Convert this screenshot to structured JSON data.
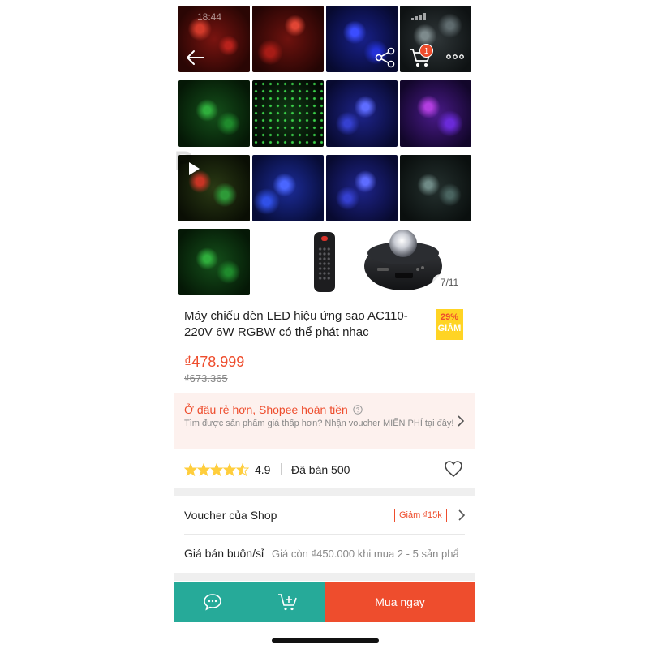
{
  "status_bar": {
    "time": "18:44"
  },
  "header": {
    "back_icon": "arrow-left-icon",
    "share_icon": "share-icon",
    "cart_icon": "cart-icon",
    "cart_count": "1",
    "more_icon": "more-dots-icon"
  },
  "gallery": {
    "pagination": "7/11",
    "play_icon": "play-icon"
  },
  "product": {
    "title": "Máy chiếu đèn LED hiệu ứng sao AC110-220V 6W RGBW có thể phát nhạc",
    "discount_percent": "29%",
    "discount_label": "GIẢM",
    "price": "₫478.999",
    "original_price": "₫673.365"
  },
  "guarantee": {
    "title": "Ở đâu rẻ hơn, Shopee hoàn tiền",
    "description": "Tìm được sản phẩm giá thấp hơn? Nhận voucher MIỄN PHÍ tại đây!"
  },
  "rating": {
    "value": "4.9",
    "sold": "Đã bán 500",
    "stars": 4.5
  },
  "voucher": {
    "label": "Voucher của Shop",
    "tag": "Giảm ₫15k"
  },
  "wholesale": {
    "label": "Giá bán buôn/sỉ",
    "value": "Giá còn ₫450.000 khi mua 2 - 5 sản phẩ"
  },
  "bottom_bar": {
    "buy_now": "Mua ngay"
  },
  "colors": {
    "brand": "#ee4d2d",
    "teal": "#26aa99",
    "discount_badge": "#ffd424"
  }
}
